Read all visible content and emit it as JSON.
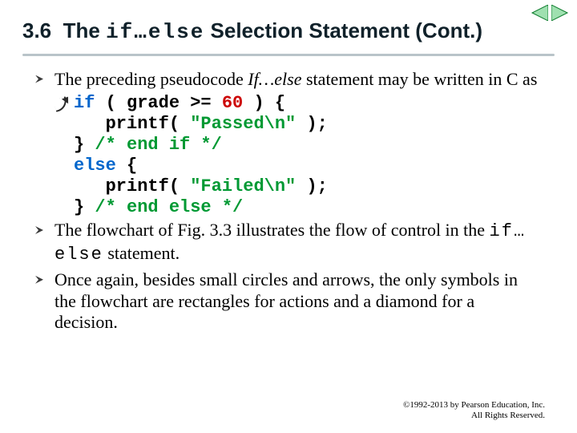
{
  "nav": {
    "prev_icon": "nav-prev-icon",
    "next_icon": "nav-next-icon"
  },
  "title": {
    "section_number": "3.6",
    "prefix": "The",
    "mono": "if…else",
    "suffix": "Selection Statement (Cont.)"
  },
  "body": {
    "para1_a": "The preceding pseudocode ",
    "para1_ital": "If…else",
    "para1_b": " statement may be written in C as",
    "code": {
      "l1_kw": "if",
      "l1_rest_a": " ( grade >= ",
      "l1_num": "60",
      "l1_rest_b": " ) {",
      "l2_a": "   printf( ",
      "l2_str": "\"Passed\\n\"",
      "l2_b": " );",
      "l3_a": "} ",
      "l3_cmt": "/* end if */",
      "l4_kw": "else",
      "l4_rest": " {",
      "l5_a": "   printf( ",
      "l5_str": "\"Failed\\n\"",
      "l5_b": " );",
      "l6_a": "} ",
      "l6_cmt": "/* end else */"
    },
    "para2_a": "The flowchart of Fig. 3.3 illustrates the flow of control in the ",
    "para2_mono": "if…else",
    "para2_b": " statement.",
    "para3": "Once again, besides small circles and arrows, the only symbols in the flowchart are rectangles for actions and a diamond for a decision."
  },
  "footer": {
    "line1": "©1992-2013 by Pearson Education, Inc.",
    "line2": "All Rights Reserved."
  }
}
